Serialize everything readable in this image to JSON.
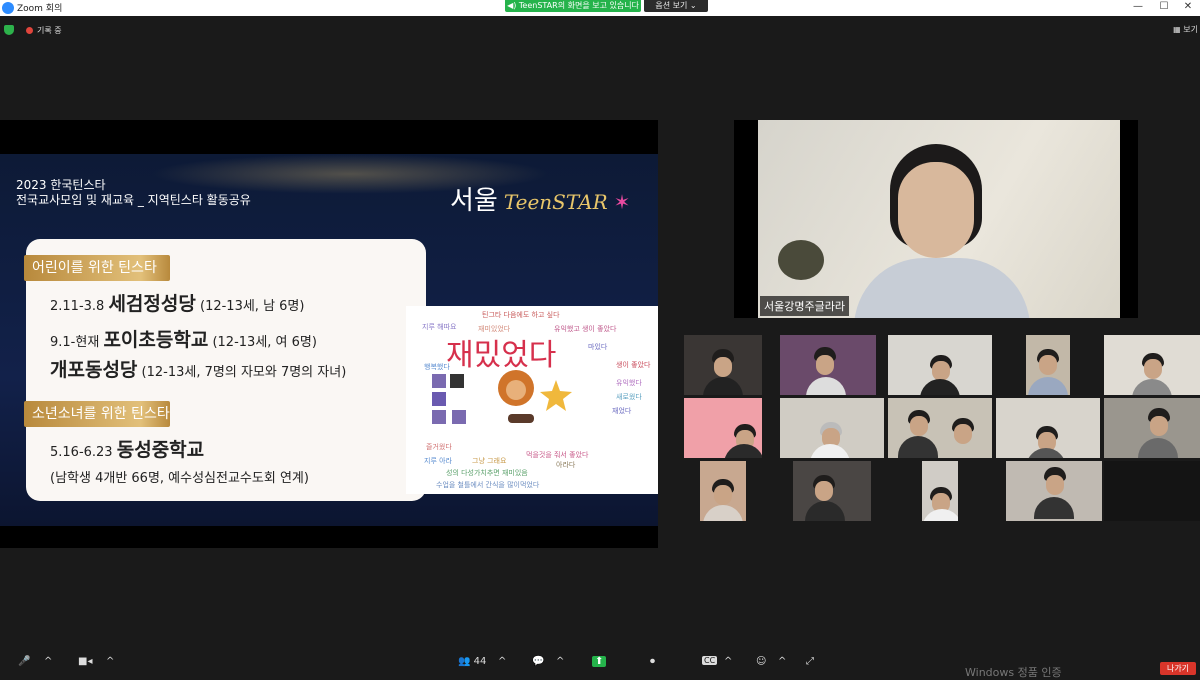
{
  "window": {
    "title": "Zoom 회의",
    "minimize": "—",
    "maximize": "☐",
    "close": "✕"
  },
  "share_banner": {
    "text": "TeenSTAR의 화면을 보고 있습니다",
    "view_options": "옵션 보기 ⌄"
  },
  "topbar": {
    "recording": "기록 중",
    "view": "보기"
  },
  "slide": {
    "header_line1": "2023 한국틴스타",
    "header_line2": "전국교사모임 및 재교육 _ 지역틴스타 활동공유",
    "logo_city": "서울",
    "logo_brand": "TeenSTAR",
    "section1": "어린이를 위한 틴스타",
    "item1_date": "2.11-3.8",
    "item1_place": "세검정성당",
    "item1_note": "(12-13세, 남 6명)",
    "item2_date": "9.1-현재",
    "item2_place": "포이초등학교",
    "item2_note": "(12-13세, 여 6명)",
    "item3_place": "개포동성당",
    "item3_note": "(12-13세, 7명의 자모와 7명의 자녀)",
    "section2": "소년소녀를 위한 틴스타",
    "item4_date": "5.16-6.23",
    "item4_place": "동성중학교",
    "item4_note": "(남학생 4개반 66명, 예수성심전교수도회 연계)"
  },
  "wordcloud": {
    "main": "재밌었다",
    "words": [
      "틴그타 다음에도 하고 싶다",
      "지루 해따요",
      "재미있었다",
      "유익했고 생이 좋았다",
      "행복했다",
      "마있다",
      "생이 좋았다",
      "유익했다",
      "새로웠다",
      "재었다",
      "즐거웠다",
      "지루 아라",
      "그냥 그래요",
      "먹을것을 줘서 좋았다",
      "아라다",
      "성의 다성가치추면 재미있음",
      "수업을 철틀에서 간식을 많이먹었다"
    ]
  },
  "slide_controls": {
    "prev": "←",
    "pen": "✎",
    "cc": "CC",
    "more": "···",
    "pen2": "✏"
  },
  "speaker": {
    "name": "서울강명주글라라"
  },
  "toolbar": {
    "mute_icon": "🎤",
    "participants_count": "44",
    "caret": "^",
    "chat": "💬",
    "share": "⬆",
    "record": "⏺",
    "cc": "CC",
    "reactions": "☺",
    "fullscreen": "⤢",
    "leave": "나가기"
  },
  "watermark": "Windows 정품 인증"
}
